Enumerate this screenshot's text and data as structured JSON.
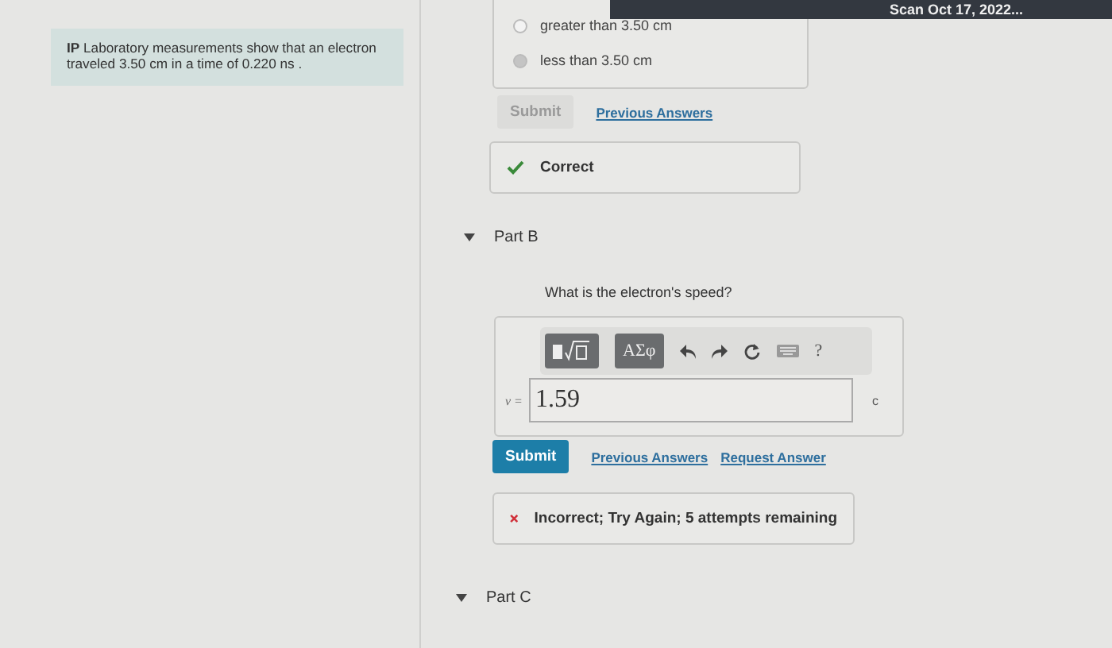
{
  "taskbar": {
    "text": "Scan Oct 17, 2022..."
  },
  "problem": {
    "text": "**IP** Laboratory measurements show that an electron traveled 3.50 cm in a time of 0.220 ns ."
  },
  "part_a": {
    "options": [
      {
        "label": "greater than 3.50 cm",
        "selected": false
      },
      {
        "label": "less than 3.50 cm",
        "selected": true
      }
    ],
    "submit": {
      "label": "Submit",
      "disabled": true
    },
    "links": [
      "Previous Answers"
    ],
    "feedback": {
      "kind": "correct",
      "text": "Correct"
    }
  },
  "parts": [
    {
      "label": "Part B",
      "expanded": true,
      "question": "What is the electron's speed?",
      "toolbar": [
        {
          "kind": "templates"
        },
        {
          "kind": "symbols",
          "label": "ΑΣφ"
        },
        {
          "kind": "undo"
        },
        {
          "kind": "redo"
        },
        {
          "kind": "reset"
        },
        {
          "kind": "keyboard"
        },
        {
          "kind": "help",
          "label": "?"
        }
      ],
      "variable": "v =",
      "value": "1.59",
      "unit": "c",
      "submit": {
        "label": "Submit",
        "disabled": false
      },
      "links": [
        "Previous Answers",
        "Request Answer"
      ],
      "feedback": {
        "kind": "incorrect",
        "text": "Incorrect; Try Again; 5 attempts remaining"
      }
    },
    {
      "label": "Part C",
      "expanded": true
    }
  ]
}
